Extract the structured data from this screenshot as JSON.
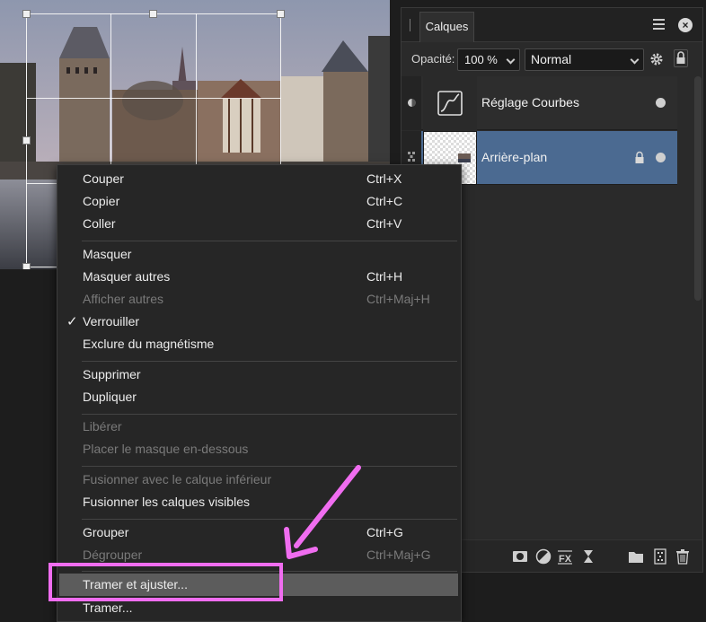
{
  "layers_panel": {
    "tab_label": "Calques",
    "opacity_label": "Opacité:",
    "opacity_value": "100 %",
    "blend_mode": "Normal",
    "icons": [
      "panel-menu-icon",
      "close-icon",
      "gear-icon",
      "lock-icon"
    ],
    "layers": [
      {
        "name": "Réglage Courbes",
        "type": "adjustment-curves",
        "locked": false,
        "selected": false
      },
      {
        "name": "Arrière-plan",
        "type": "pixel",
        "locked": true,
        "selected": true
      }
    ],
    "toolbar_icons": [
      "mask-icon",
      "adjustment-icon",
      "fx-icon",
      "hourglass-icon",
      "folder-icon",
      "new-layer-icon",
      "trash-icon"
    ]
  },
  "context_menu": {
    "items": [
      {
        "label": "Couper",
        "shortcut": "Ctrl+X",
        "enabled": true
      },
      {
        "label": "Copier",
        "shortcut": "Ctrl+C",
        "enabled": true
      },
      {
        "label": "Coller",
        "shortcut": "Ctrl+V",
        "enabled": true
      },
      {
        "label": "Masquer",
        "shortcut": "",
        "enabled": true
      },
      {
        "label": "Masquer autres",
        "shortcut": "Ctrl+H",
        "enabled": true
      },
      {
        "label": "Afficher autres",
        "shortcut": "Ctrl+Maj+H",
        "enabled": false
      },
      {
        "label": "Verrouiller",
        "shortcut": "",
        "enabled": true,
        "checked": true
      },
      {
        "label": "Exclure du magnétisme",
        "shortcut": "",
        "enabled": true
      },
      {
        "label": "Supprimer",
        "shortcut": "",
        "enabled": true
      },
      {
        "label": "Dupliquer",
        "shortcut": "",
        "enabled": true
      },
      {
        "label": "Libérer",
        "shortcut": "",
        "enabled": false
      },
      {
        "label": "Placer le masque en-dessous",
        "shortcut": "",
        "enabled": false
      },
      {
        "label": "Fusionner avec le calque inférieur",
        "shortcut": "",
        "enabled": false
      },
      {
        "label": "Fusionner les calques visibles",
        "shortcut": "",
        "enabled": true
      },
      {
        "label": "Grouper",
        "shortcut": "Ctrl+G",
        "enabled": true
      },
      {
        "label": "Dégrouper",
        "shortcut": "Ctrl+Maj+G",
        "enabled": false
      },
      {
        "label": "Tramer et ajuster...",
        "shortcut": "",
        "enabled": true,
        "highlighted": true
      },
      {
        "label": "Tramer...",
        "shortcut": "",
        "enabled": true
      }
    ],
    "check_glyph": "✓"
  },
  "annotation": {
    "color": "#f06df0",
    "target": "Tramer et ajuster..."
  },
  "colors": {
    "selected_layer": "#4b6a91",
    "menu_highlight": "#5c5c5c",
    "annotation": "#f06df0"
  }
}
